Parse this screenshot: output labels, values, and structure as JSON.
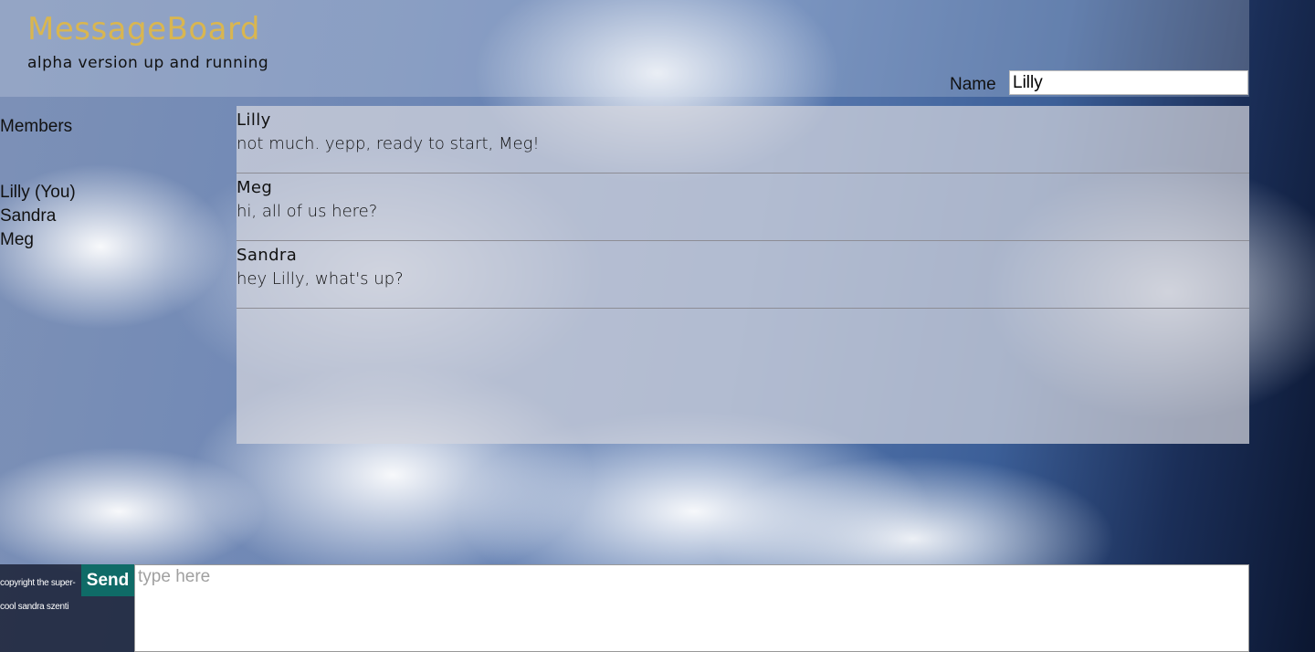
{
  "header": {
    "title": "MessageBoard",
    "subtitle": "alpha version up and running",
    "name_label": "Name",
    "name_value": "Lilly"
  },
  "members": {
    "heading": "Members",
    "items": [
      "Lilly (You)",
      "Sandra",
      "Meg"
    ]
  },
  "messages": [
    {
      "author": "Lilly",
      "text": "not much. yepp, ready to start, Meg!"
    },
    {
      "author": "Meg",
      "text": "hi, all of us here?"
    },
    {
      "author": "Sandra",
      "text": "hey Lilly, what's up?"
    }
  ],
  "composer": {
    "send_label": "Send",
    "placeholder": "type here",
    "value": ""
  },
  "footer": {
    "copyright": "copyright the super-cool sandra szenti"
  },
  "colors": {
    "brand": "#d9b650",
    "send_button": "#0f6b67"
  }
}
